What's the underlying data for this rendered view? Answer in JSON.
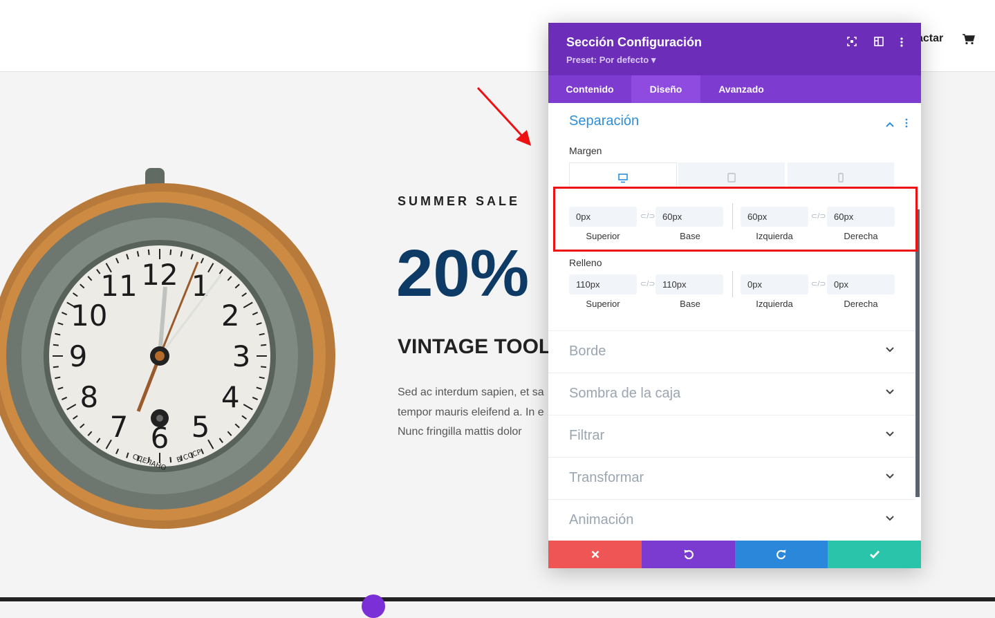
{
  "site": {
    "nav_contact": "actar",
    "cart_icon": "cart-icon"
  },
  "hero": {
    "eyebrow": "SUMMER SALE",
    "discount": "20%",
    "heading": "VINTAGE TOOL",
    "text_lines": [
      "Sed ac interdum sapien, et sa",
      "tempor mauris eleifend a. In e",
      "Nunc fringilla mattis dolor"
    ],
    "clock_numbers": [
      "12",
      "1",
      "2",
      "3",
      "4",
      "5",
      "6",
      "7",
      "8",
      "9",
      "10",
      "11"
    ],
    "clock_text_left": "СДЕЛАНО",
    "clock_text_right": "В СССР"
  },
  "panel": {
    "title": "Sección Configuración",
    "preset": "Preset: Por defecto ▾",
    "header_icons": [
      "focus-icon",
      "layout-icon",
      "more-vertical-icon"
    ],
    "tabs": [
      {
        "label": "Contenido"
      },
      {
        "label": "Diseño",
        "active": true
      },
      {
        "label": "Avanzado"
      }
    ],
    "section": {
      "title": "Separación",
      "margin_label": "Margen",
      "device_tabs": [
        "desktop-icon",
        "tablet-icon",
        "phone-icon"
      ],
      "margin": [
        {
          "value": "0px",
          "caption": "Superior"
        },
        {
          "value": "60px",
          "caption": "Base"
        },
        {
          "value": "60px",
          "caption": "Izquierda"
        },
        {
          "value": "60px",
          "caption": "Derecha"
        }
      ],
      "padding_label": "Relleno",
      "padding": [
        {
          "value": "110px",
          "caption": "Superior"
        },
        {
          "value": "110px",
          "caption": "Base"
        },
        {
          "value": "0px",
          "caption": "Izquierda"
        },
        {
          "value": "0px",
          "caption": "Derecha"
        }
      ]
    },
    "accordions": [
      "Borde",
      "Sombra de la caja",
      "Filtrar",
      "Transformar",
      "Animación"
    ],
    "action_colors": {
      "cancel": "#ef5555",
      "undo": "#7b3bd0",
      "redo": "#2b87da",
      "save": "#29c4a9"
    }
  }
}
